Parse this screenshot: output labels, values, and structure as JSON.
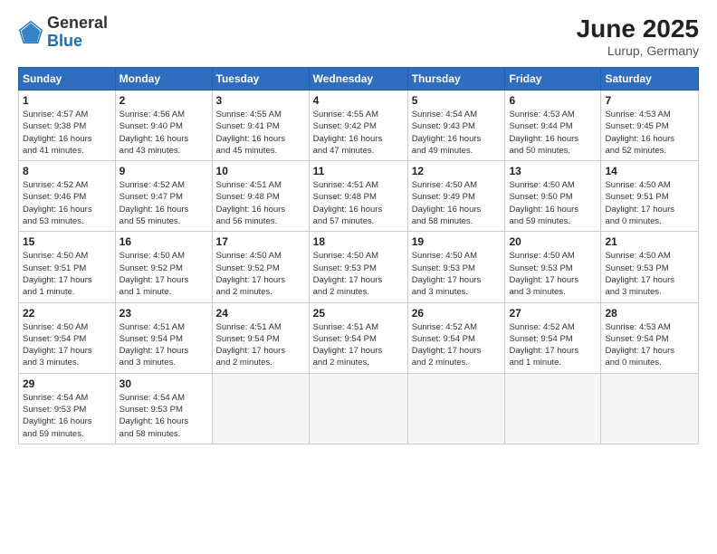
{
  "header": {
    "logo_general": "General",
    "logo_blue": "Blue",
    "month": "June 2025",
    "location": "Lurup, Germany"
  },
  "weekdays": [
    "Sunday",
    "Monday",
    "Tuesday",
    "Wednesday",
    "Thursday",
    "Friday",
    "Saturday"
  ],
  "weeks": [
    [
      {
        "day": "1",
        "info": "Sunrise: 4:57 AM\nSunset: 9:38 PM\nDaylight: 16 hours\nand 41 minutes."
      },
      {
        "day": "2",
        "info": "Sunrise: 4:56 AM\nSunset: 9:40 PM\nDaylight: 16 hours\nand 43 minutes."
      },
      {
        "day": "3",
        "info": "Sunrise: 4:55 AM\nSunset: 9:41 PM\nDaylight: 16 hours\nand 45 minutes."
      },
      {
        "day": "4",
        "info": "Sunrise: 4:55 AM\nSunset: 9:42 PM\nDaylight: 16 hours\nand 47 minutes."
      },
      {
        "day": "5",
        "info": "Sunrise: 4:54 AM\nSunset: 9:43 PM\nDaylight: 16 hours\nand 49 minutes."
      },
      {
        "day": "6",
        "info": "Sunrise: 4:53 AM\nSunset: 9:44 PM\nDaylight: 16 hours\nand 50 minutes."
      },
      {
        "day": "7",
        "info": "Sunrise: 4:53 AM\nSunset: 9:45 PM\nDaylight: 16 hours\nand 52 minutes."
      }
    ],
    [
      {
        "day": "8",
        "info": "Sunrise: 4:52 AM\nSunset: 9:46 PM\nDaylight: 16 hours\nand 53 minutes."
      },
      {
        "day": "9",
        "info": "Sunrise: 4:52 AM\nSunset: 9:47 PM\nDaylight: 16 hours\nand 55 minutes."
      },
      {
        "day": "10",
        "info": "Sunrise: 4:51 AM\nSunset: 9:48 PM\nDaylight: 16 hours\nand 56 minutes."
      },
      {
        "day": "11",
        "info": "Sunrise: 4:51 AM\nSunset: 9:48 PM\nDaylight: 16 hours\nand 57 minutes."
      },
      {
        "day": "12",
        "info": "Sunrise: 4:50 AM\nSunset: 9:49 PM\nDaylight: 16 hours\nand 58 minutes."
      },
      {
        "day": "13",
        "info": "Sunrise: 4:50 AM\nSunset: 9:50 PM\nDaylight: 16 hours\nand 59 minutes."
      },
      {
        "day": "14",
        "info": "Sunrise: 4:50 AM\nSunset: 9:51 PM\nDaylight: 17 hours\nand 0 minutes."
      }
    ],
    [
      {
        "day": "15",
        "info": "Sunrise: 4:50 AM\nSunset: 9:51 PM\nDaylight: 17 hours\nand 1 minute."
      },
      {
        "day": "16",
        "info": "Sunrise: 4:50 AM\nSunset: 9:52 PM\nDaylight: 17 hours\nand 1 minute."
      },
      {
        "day": "17",
        "info": "Sunrise: 4:50 AM\nSunset: 9:52 PM\nDaylight: 17 hours\nand 2 minutes."
      },
      {
        "day": "18",
        "info": "Sunrise: 4:50 AM\nSunset: 9:53 PM\nDaylight: 17 hours\nand 2 minutes."
      },
      {
        "day": "19",
        "info": "Sunrise: 4:50 AM\nSunset: 9:53 PM\nDaylight: 17 hours\nand 3 minutes."
      },
      {
        "day": "20",
        "info": "Sunrise: 4:50 AM\nSunset: 9:53 PM\nDaylight: 17 hours\nand 3 minutes."
      },
      {
        "day": "21",
        "info": "Sunrise: 4:50 AM\nSunset: 9:53 PM\nDaylight: 17 hours\nand 3 minutes."
      }
    ],
    [
      {
        "day": "22",
        "info": "Sunrise: 4:50 AM\nSunset: 9:54 PM\nDaylight: 17 hours\nand 3 minutes."
      },
      {
        "day": "23",
        "info": "Sunrise: 4:51 AM\nSunset: 9:54 PM\nDaylight: 17 hours\nand 3 minutes."
      },
      {
        "day": "24",
        "info": "Sunrise: 4:51 AM\nSunset: 9:54 PM\nDaylight: 17 hours\nand 2 minutes."
      },
      {
        "day": "25",
        "info": "Sunrise: 4:51 AM\nSunset: 9:54 PM\nDaylight: 17 hours\nand 2 minutes."
      },
      {
        "day": "26",
        "info": "Sunrise: 4:52 AM\nSunset: 9:54 PM\nDaylight: 17 hours\nand 2 minutes."
      },
      {
        "day": "27",
        "info": "Sunrise: 4:52 AM\nSunset: 9:54 PM\nDaylight: 17 hours\nand 1 minute."
      },
      {
        "day": "28",
        "info": "Sunrise: 4:53 AM\nSunset: 9:54 PM\nDaylight: 17 hours\nand 0 minutes."
      }
    ],
    [
      {
        "day": "29",
        "info": "Sunrise: 4:54 AM\nSunset: 9:53 PM\nDaylight: 16 hours\nand 59 minutes."
      },
      {
        "day": "30",
        "info": "Sunrise: 4:54 AM\nSunset: 9:53 PM\nDaylight: 16 hours\nand 58 minutes."
      },
      {
        "day": "",
        "info": ""
      },
      {
        "day": "",
        "info": ""
      },
      {
        "day": "",
        "info": ""
      },
      {
        "day": "",
        "info": ""
      },
      {
        "day": "",
        "info": ""
      }
    ]
  ]
}
